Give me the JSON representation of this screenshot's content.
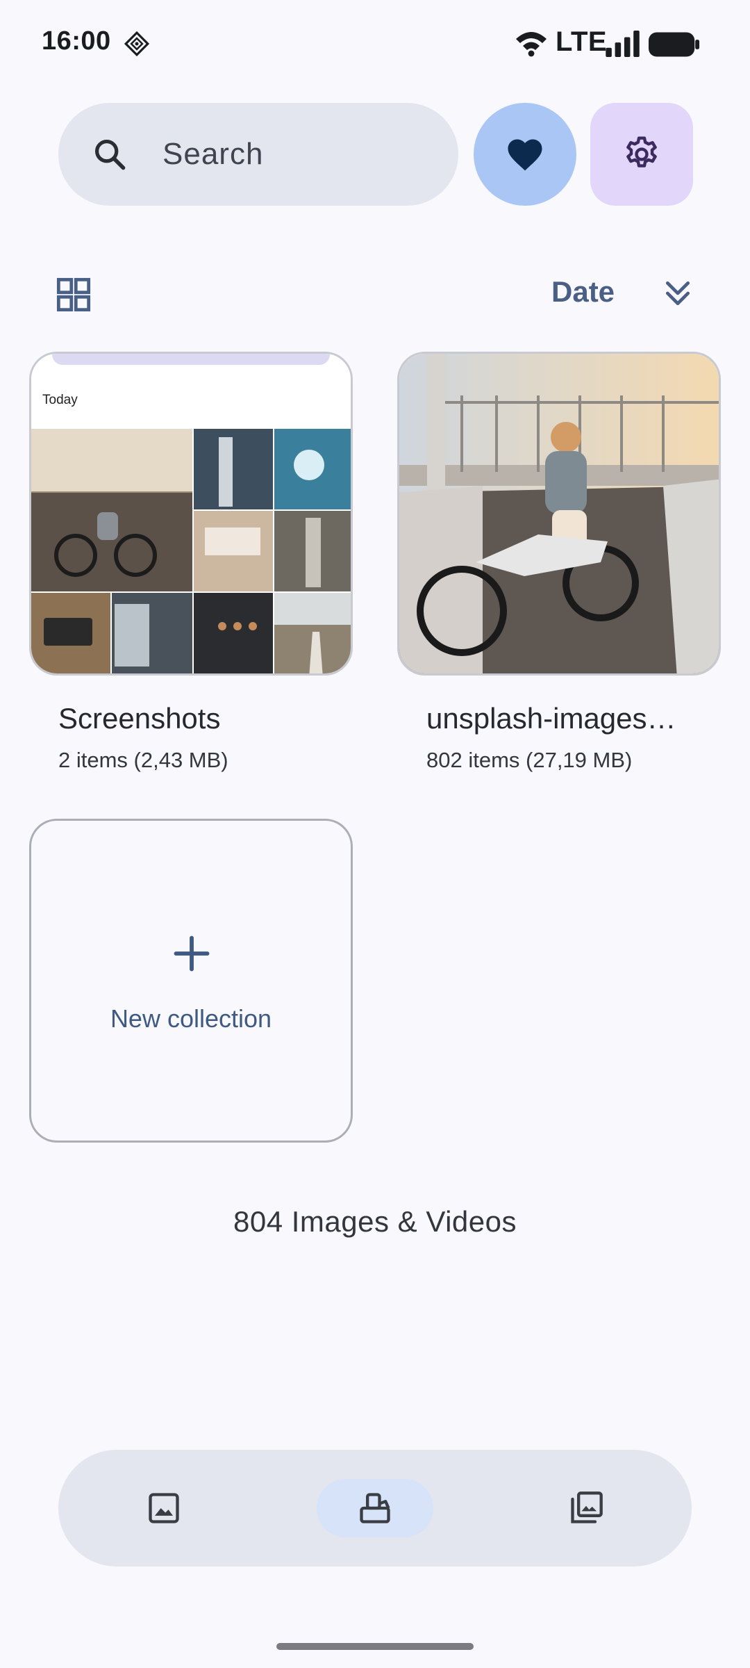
{
  "status_bar": {
    "time": "16:00",
    "network": "LTE",
    "icons": [
      "app-notification-icon",
      "wifi-icon",
      "signal-icon",
      "battery-icon"
    ]
  },
  "header": {
    "search_placeholder": "Search",
    "favorites_icon": "heart-icon",
    "settings_icon": "gear-icon"
  },
  "toolbar": {
    "sort_label": "Date",
    "layout_icon": "grid-icon",
    "sort_icon": "double-chevron-down-icon"
  },
  "albums": [
    {
      "title": "Screenshots",
      "meta": "2 items (2,43 MB)",
      "header_label": "Today"
    },
    {
      "title": "unsplash-images…",
      "meta": "802 items (27,19 MB)"
    }
  ],
  "new_collection": {
    "label": "New collection",
    "icon": "plus-icon"
  },
  "total": "804 Images & Videos",
  "bottom_nav": {
    "items": [
      {
        "name": "photos",
        "icon": "image-icon",
        "selected": false
      },
      {
        "name": "albums",
        "icon": "albums-icon",
        "selected": true
      },
      {
        "name": "library",
        "icon": "library-icon",
        "selected": false
      }
    ]
  },
  "colors": {
    "background": "#f8f8fd",
    "search_bg": "#e3e6ee",
    "favorites_bg": "#a9c6f5",
    "settings_bg": "#e3d6fb",
    "accent": "#4a5f85"
  }
}
